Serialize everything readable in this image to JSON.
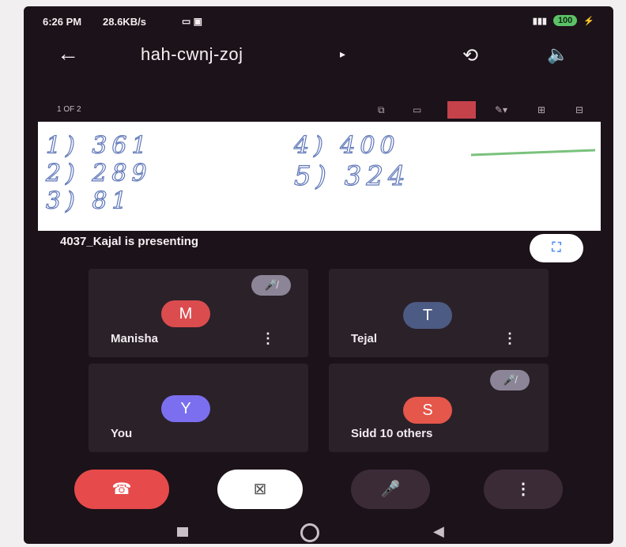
{
  "status": {
    "time": "6:26 PM",
    "speed": "28.6KB/s",
    "battery": "100"
  },
  "app": {
    "title": "hah-cwnj-zoj",
    "caret": "▸"
  },
  "presentation": {
    "page": "1 OF 2",
    "answers": [
      "1) 361",
      "2) 289",
      "3) 81",
      "4) 400",
      "5) 324"
    ],
    "presenter": "4037_Kajal is presenting"
  },
  "participants": [
    {
      "initial": "M",
      "name": "Manisha",
      "color": "#db4c4f",
      "muted": true
    },
    {
      "initial": "T",
      "name": "Tejal",
      "color": "#4c5b83",
      "muted": false
    },
    {
      "initial": "Y",
      "name": "You",
      "color": "#7b6ff0",
      "muted": false
    },
    {
      "initial": "S",
      "name": "Sidd 10 others",
      "color": "#e5564b",
      "muted": true
    }
  ],
  "icons": {
    "back": "←",
    "switch": "⟲",
    "speaker": "🔈",
    "fullscreen": "⛶",
    "menu": "⋮",
    "end": "☎",
    "camera": "⊠",
    "mic": "🎤",
    "more": "⋮",
    "mute": "🎤̸"
  }
}
